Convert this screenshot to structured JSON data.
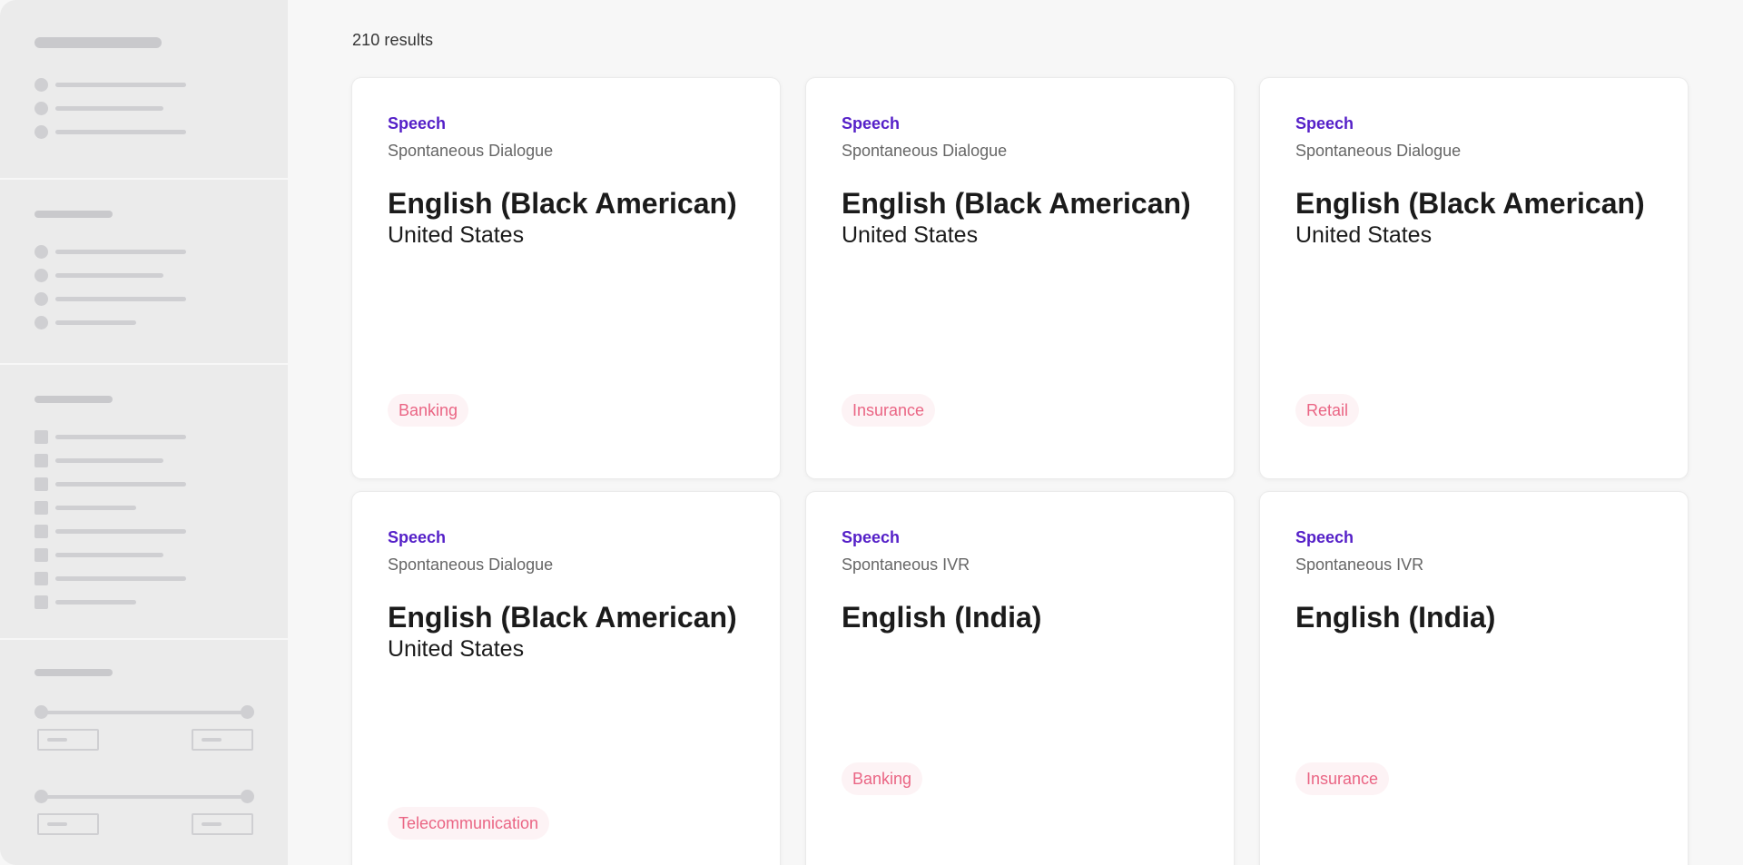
{
  "results_count": "210 results",
  "colors": {
    "category": "#5520c8",
    "tag_text": "#ea6584",
    "tag_background": "#fdf3f5",
    "skeleton": "#cfcfd2"
  },
  "cards": [
    {
      "category": "Speech",
      "subtype": "Spontaneous Dialogue",
      "language": "English (Black American)",
      "country": "United States",
      "tag": "Banking"
    },
    {
      "category": "Speech",
      "subtype": "Spontaneous Dialogue",
      "language": "English (Black American)",
      "country": "United States",
      "tag": "Insurance"
    },
    {
      "category": "Speech",
      "subtype": "Spontaneous Dialogue",
      "language": "English (Black American)",
      "country": "United States",
      "tag": "Retail"
    },
    {
      "category": "Speech",
      "subtype": "Spontaneous Dialogue",
      "language": "English (Black American)",
      "country": "United States",
      "tag": "Telecommunication"
    },
    {
      "category": "Speech",
      "subtype": "Spontaneous IVR",
      "language": "English (India)",
      "country": "",
      "tag": "Banking"
    },
    {
      "category": "Speech",
      "subtype": "Spontaneous IVR",
      "language": "English (India)",
      "country": "",
      "tag": "Insurance"
    }
  ]
}
